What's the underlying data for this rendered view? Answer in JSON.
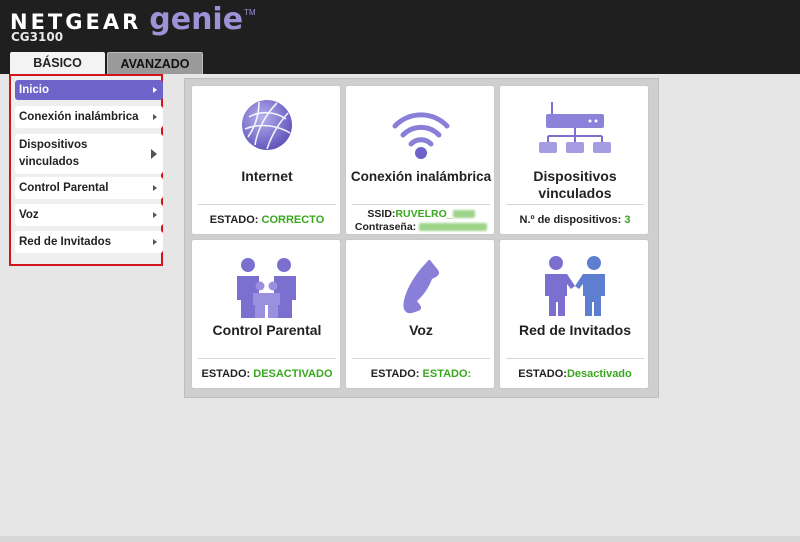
{
  "header": {
    "brand_netgear": "NETGEAR",
    "brand_genie": "genie",
    "brand_tm": "TM",
    "model": "CG3100"
  },
  "tabs": [
    {
      "label": "BÁSICO",
      "selected": true
    },
    {
      "label": "AVANZADO",
      "selected": false
    }
  ],
  "sidebar": {
    "items": [
      {
        "label": "Inicio",
        "active": true
      },
      {
        "label": "Conexión inalámbrica",
        "active": false
      },
      {
        "label": "Dispositivos",
        "label2": "vinculados",
        "active": false
      },
      {
        "label": "Control Parental",
        "active": false
      },
      {
        "label": "Voz",
        "active": false
      },
      {
        "label": "Red de Invitados",
        "active": false
      }
    ]
  },
  "cards": {
    "internet": {
      "title": "Internet",
      "status_label": "ESTADO:",
      "status_value": "CORRECTO",
      "icon": "globe-icon"
    },
    "wireless": {
      "title": "Conexión inalámbrica",
      "ssid_label": "SSID:",
      "ssid_value": "RUVELRO_",
      "password_label": "Contraseña:",
      "icon": "wifi-icon"
    },
    "devices": {
      "title": "Dispositivos",
      "title2": "vinculados",
      "count_label": "N.º de dispositivos:",
      "count_value": "3",
      "icon": "network-devices-icon"
    },
    "parental": {
      "title": "Control Parental",
      "status_label": "ESTADO:",
      "status_value": "DESACTIVADO",
      "icon": "family-icon"
    },
    "voice": {
      "title": "Voz",
      "status_label": "ESTADO:",
      "status_value": "ESTADO:",
      "icon": "phone-icon"
    },
    "guest": {
      "title": "Red de Invitados",
      "status_label": "ESTADO:",
      "status_value": "Desactivado",
      "icon": "handshake-icon"
    }
  },
  "colors": {
    "accent": "#6e63c9",
    "icon_purple": "#7b6fcf",
    "status_green": "#3aa71f",
    "highlight_red": "#d2151b",
    "header_bg": "#1f1f1f"
  }
}
